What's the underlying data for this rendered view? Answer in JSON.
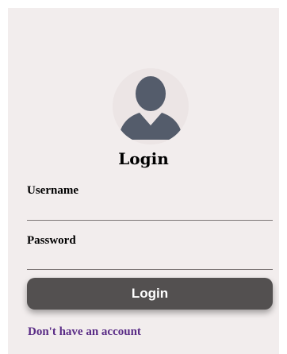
{
  "form": {
    "avatar_icon": "user-silhouette-icon",
    "title": "Login",
    "username_label": "Username",
    "username_value": "",
    "password_label": "Password",
    "password_value": "",
    "login_button_label": "Login",
    "signup_link_text": "Don't have an account"
  },
  "colors": {
    "card_background": "#f2eded",
    "avatar_icon": "#545c6b",
    "button_background": "#535050",
    "link": "#5a2c86"
  }
}
